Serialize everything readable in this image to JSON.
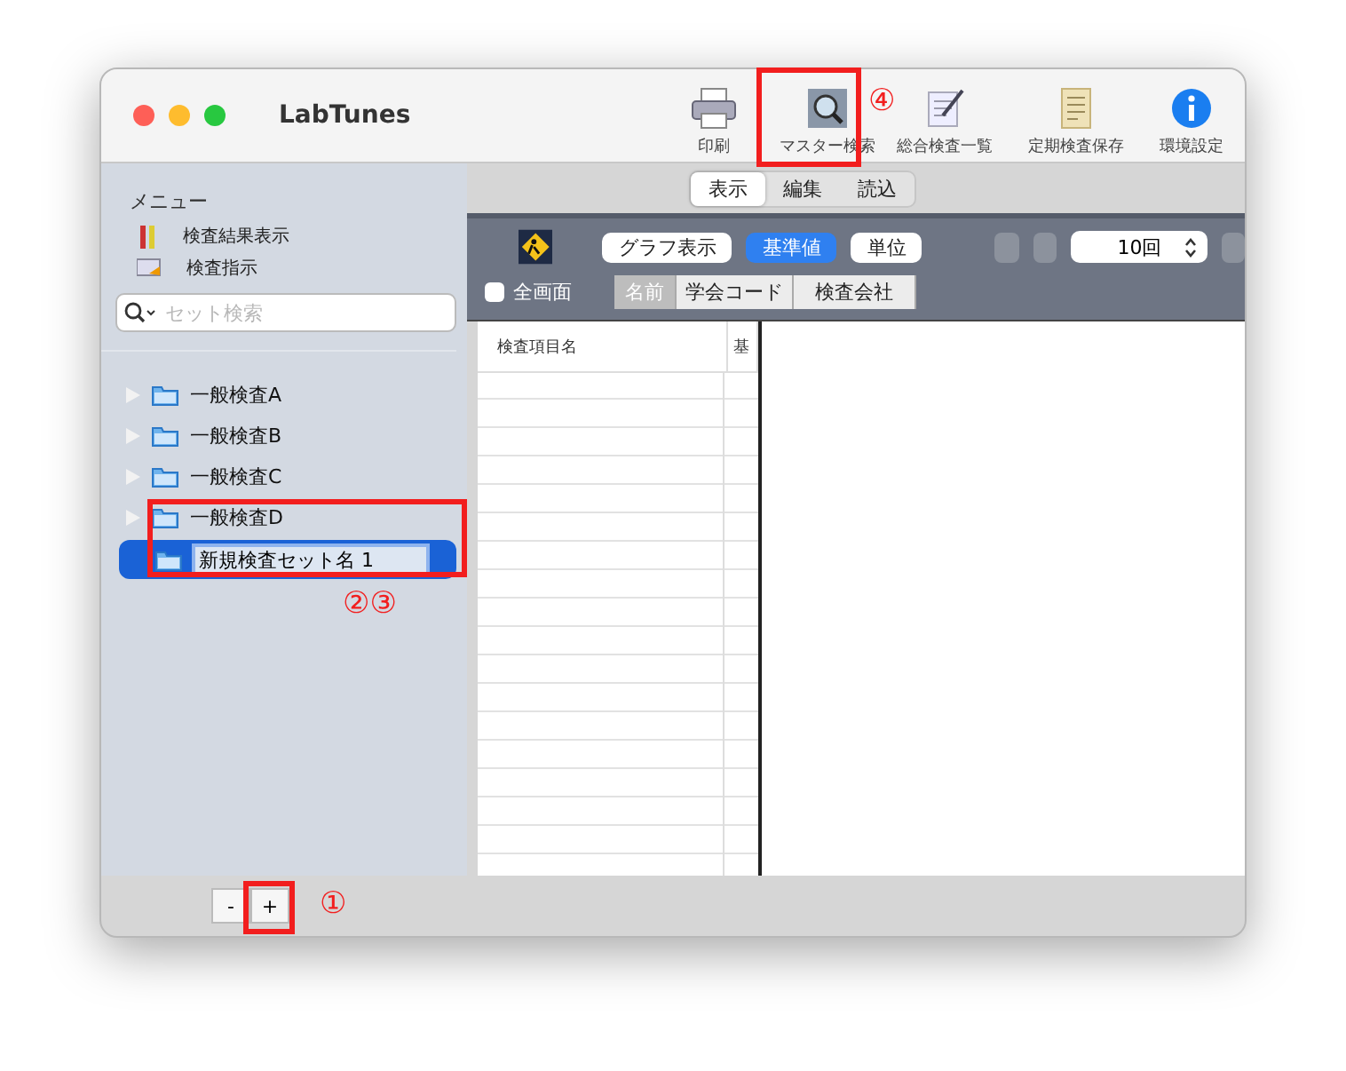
{
  "window": {
    "title": "LabTunes"
  },
  "toolbar": [
    {
      "label": "印刷",
      "kind": "printer"
    },
    {
      "label": "マスター検索",
      "kind": "search"
    },
    {
      "label": "総合検査一覧",
      "kind": "list"
    },
    {
      "label": "定期検査保存",
      "kind": "save"
    },
    {
      "label": "環境設定",
      "kind": "info"
    }
  ],
  "view_tabs": [
    {
      "label": "表示",
      "selected": true
    },
    {
      "label": "編集",
      "selected": false
    },
    {
      "label": "読込",
      "selected": false
    }
  ],
  "sidebar": {
    "heading": "メニュー",
    "menu": [
      {
        "label": "検査結果表示",
        "kind": "tubes"
      },
      {
        "label": "検査指示",
        "kind": "order"
      }
    ],
    "search": {
      "placeholder": "セット検索"
    },
    "sets": [
      {
        "label": "一般検査A",
        "expanded": false
      },
      {
        "label": "一般検査B",
        "expanded": false
      },
      {
        "label": "一般検査C",
        "expanded": false
      },
      {
        "label": "一般検査D",
        "expanded": false
      }
    ],
    "new_set": {
      "value": "新規検査セット名 1",
      "selected": true
    }
  },
  "panel": {
    "buttons": [
      {
        "label": "グラフ表示",
        "selected": false
      },
      {
        "label": "基準値",
        "selected": true
      },
      {
        "label": "単位",
        "selected": false
      }
    ],
    "count": "10回",
    "fullscreen": {
      "label": "全画面",
      "checked": false
    },
    "sort_tabs": [
      {
        "label": "名前",
        "selected": true
      },
      {
        "label": "学会コード",
        "selected": false
      },
      {
        "label": "検査会社",
        "selected": false
      }
    ]
  },
  "table": {
    "columns": [
      "検査項目名",
      "基"
    ]
  },
  "footer": {
    "buttons": [
      "-",
      "+"
    ]
  },
  "annotations": [
    {
      "label": "④"
    },
    {
      "label": "②③"
    },
    {
      "label": "①"
    }
  ]
}
